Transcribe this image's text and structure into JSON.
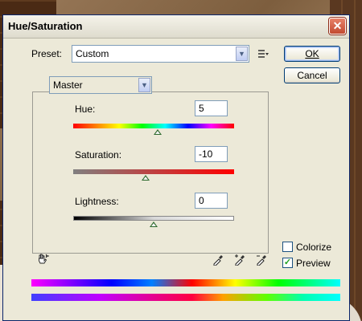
{
  "window": {
    "title": "Hue/Saturation"
  },
  "preset": {
    "label": "Preset:",
    "value": "Custom"
  },
  "buttons": {
    "ok": "OK",
    "cancel": "Cancel"
  },
  "channel": {
    "value": "Master"
  },
  "hue": {
    "label": "Hue:",
    "value": "5",
    "level": 0.525
  },
  "saturation": {
    "label": "Saturation:",
    "value": "-10",
    "level": 0.45
  },
  "lightness": {
    "label": "Lightness:",
    "value": "0",
    "level": 0.5
  },
  "colorize": {
    "label": "Colorize",
    "checked": false
  },
  "preview": {
    "label": "Preview",
    "checked": true
  },
  "icons": {
    "close": "close-icon",
    "preset_options": "preset-options-icon",
    "targeted_adjustment": "targeted-adjustment-hand-icon",
    "eyedropper": "eyedropper-icon",
    "eyedropper_plus": "eyedropper-plus-icon",
    "eyedropper_minus": "eyedropper-minus-icon"
  },
  "close_glyph": "✕"
}
